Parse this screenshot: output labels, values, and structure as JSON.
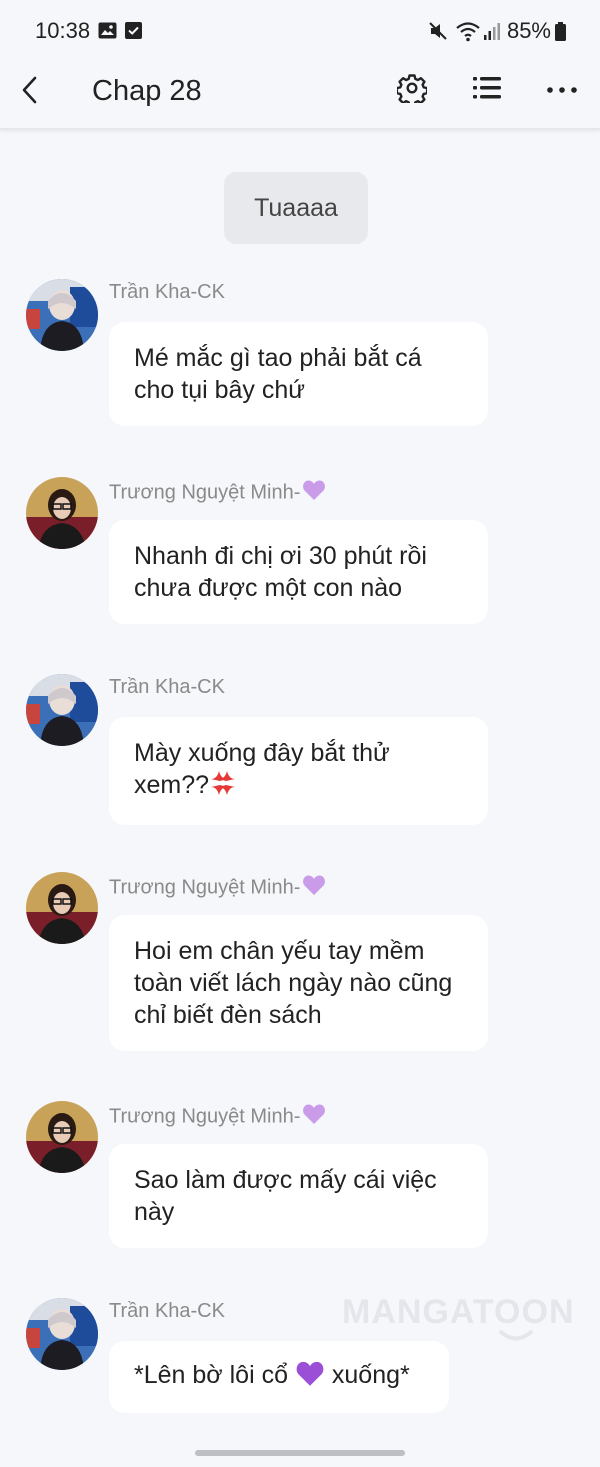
{
  "status_bar": {
    "time": "10:38",
    "battery": "85%",
    "icons": [
      "gallery-icon",
      "checkbox-icon",
      "mute-icon",
      "wifi-icon",
      "signal-icon",
      "battery-icon"
    ]
  },
  "header": {
    "title": "Chap 28",
    "icons": [
      "back-icon",
      "settings-icon",
      "list-icon",
      "more-icon"
    ]
  },
  "system_message": "Tuaaaa",
  "messages": [
    {
      "sender": "Trần Kha-CK",
      "heart": false,
      "text": "Mé mắc gì tao phải bắt cá cho tụi bây chứ"
    },
    {
      "sender": "Trương Nguyệt Minh-",
      "heart": true,
      "text": "Nhanh đi chị ơi 30 phút rồi chưa được một con nào"
    },
    {
      "sender": "Trần Kha-CK",
      "heart": false,
      "text": "Mày xuống đây bắt thử xem??",
      "emoji": "anger-icon"
    },
    {
      "sender": "Trương Nguyệt Minh-",
      "heart": true,
      "text": "Hoi em chân yếu tay mềm toàn viết lách ngày nào cũng chỉ biết đèn sách"
    },
    {
      "sender": "Trương Nguyệt Minh-",
      "heart": true,
      "text": "Sao làm được mấy cái việc này"
    },
    {
      "sender": "Trần Kha-CK",
      "heart": false,
      "text_before": "*Lên bờ lôi cổ ",
      "text_after": " xuống*",
      "emoji": "purple-heart-icon"
    }
  ],
  "watermark": "MANGATOON",
  "colors": {
    "background": "#f6f7fa",
    "bubble": "#ffffff",
    "system_bubble": "#e8e9ec",
    "sender_text": "#8a8a8a",
    "heart": "#b57edc"
  }
}
